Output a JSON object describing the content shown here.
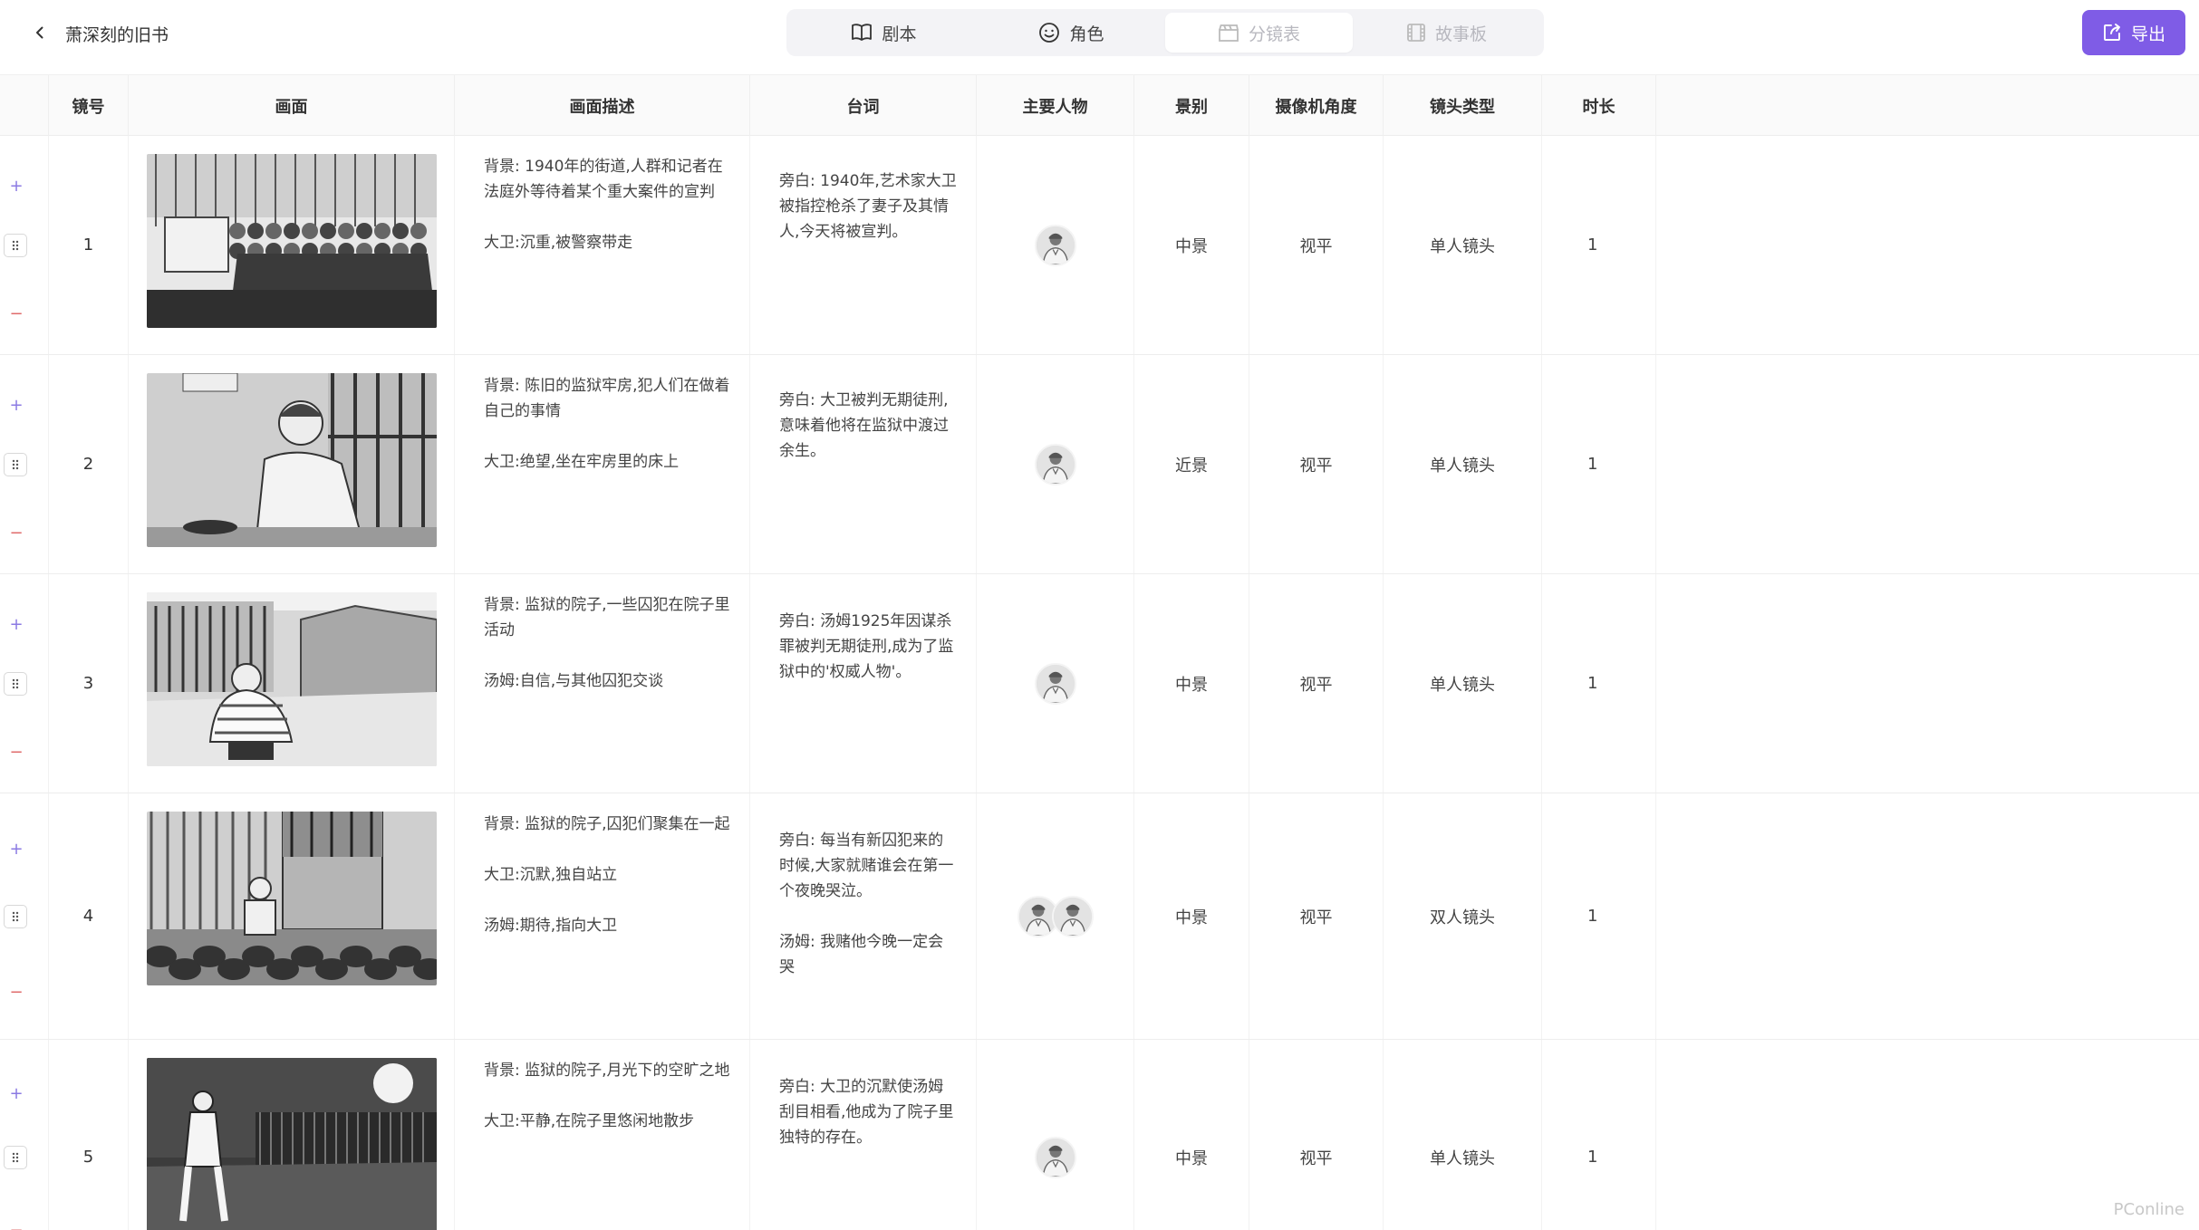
{
  "header": {
    "project_title": "萧深刻的旧书",
    "tabs": [
      {
        "label": "剧本",
        "icon": "book-icon",
        "state": "normal"
      },
      {
        "label": "角色",
        "icon": "smiley-icon",
        "state": "normal"
      },
      {
        "label": "分镜表",
        "icon": "clapperboard-icon",
        "state": "active"
      },
      {
        "label": "故事板",
        "icon": "film-icon",
        "state": "dim"
      }
    ],
    "export_label": "导出",
    "accent_color": "#7f5ce6"
  },
  "table": {
    "columns": [
      "镜号",
      "画面",
      "画面描述",
      "台词",
      "主要人物",
      "景别",
      "摄像机角度",
      "镜头类型",
      "时长"
    ],
    "rows": [
      {
        "shot": "1",
        "description": [
          "背景: 1940年的街道,人群和记者在法庭外等待着某个重大案件的宣判",
          "大卫:沉重,被警察带走"
        ],
        "dialogue": [
          "旁白: 1940年,艺术家大卫被指控枪杀了妻子及其情人,今天将被宣判。"
        ],
        "characters": 1,
        "framing": "中景",
        "angle": "视平",
        "lens": "单人镜头",
        "duration": "1"
      },
      {
        "shot": "2",
        "description": [
          "背景: 陈旧的监狱牢房,犯人们在做着自己的事情",
          "大卫:绝望,坐在牢房里的床上"
        ],
        "dialogue": [
          "旁白: 大卫被判无期徒刑,意味着他将在监狱中渡过余生。"
        ],
        "characters": 1,
        "framing": "近景",
        "angle": "视平",
        "lens": "单人镜头",
        "duration": "1"
      },
      {
        "shot": "3",
        "description": [
          "背景: 监狱的院子,一些囚犯在院子里活动",
          "汤姆:自信,与其他囚犯交谈"
        ],
        "dialogue": [
          "旁白: 汤姆1925年因谋杀罪被判无期徒刑,成为了监狱中的'权威人物'。"
        ],
        "characters": 1,
        "framing": "中景",
        "angle": "视平",
        "lens": "单人镜头",
        "duration": "1"
      },
      {
        "shot": "4",
        "description": [
          "背景: 监狱的院子,囚犯们聚集在一起",
          "大卫:沉默,独自站立",
          "汤姆:期待,指向大卫"
        ],
        "dialogue": [
          "旁白: 每当有新囚犯来的时候,大家就赌谁会在第一个夜晚哭泣。",
          "汤姆: 我赌他今晚一定会哭"
        ],
        "characters": 2,
        "framing": "中景",
        "angle": "视平",
        "lens": "双人镜头",
        "duration": "1"
      },
      {
        "shot": "5",
        "description": [
          "背景: 监狱的院子,月光下的空旷之地",
          "大卫:平静,在院子里悠闲地散步"
        ],
        "dialogue": [
          "旁白: 大卫的沉默使汤姆刮目相看,他成为了院子里独特的存在。"
        ],
        "characters": 1,
        "framing": "中景",
        "angle": "视平",
        "lens": "单人镜头",
        "duration": "1"
      }
    ]
  },
  "watermark": "PConline"
}
